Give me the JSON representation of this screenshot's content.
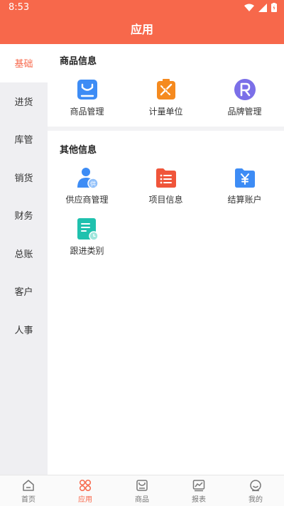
{
  "status_bar": {
    "time": "8:53"
  },
  "header": {
    "title": "应用"
  },
  "sidebar": {
    "items": [
      {
        "label": "基础",
        "active": true
      },
      {
        "label": "进货"
      },
      {
        "label": "库管"
      },
      {
        "label": "销货"
      },
      {
        "label": "财务"
      },
      {
        "label": "总账"
      },
      {
        "label": "客户"
      },
      {
        "label": "人事"
      }
    ]
  },
  "sections": [
    {
      "title": "商品信息",
      "items": [
        {
          "label": "商品管理",
          "icon": "shopping-bag-icon"
        },
        {
          "label": "计量单位",
          "icon": "ruler-pencil-icon"
        },
        {
          "label": "品牌管理",
          "icon": "brand-r-icon"
        }
      ]
    },
    {
      "title": "其他信息",
      "items": [
        {
          "label": "供应商管理",
          "icon": "supplier-icon"
        },
        {
          "label": "项目信息",
          "icon": "list-folder-icon"
        },
        {
          "label": "结算账户",
          "icon": "yen-folder-icon"
        },
        {
          "label": "跟进类别",
          "icon": "follow-note-icon"
        }
      ]
    }
  ],
  "bottom_nav": {
    "tabs": [
      {
        "label": "首页",
        "icon": "home-icon"
      },
      {
        "label": "应用",
        "icon": "apps-icon",
        "active": true
      },
      {
        "label": "商品",
        "icon": "box-icon"
      },
      {
        "label": "报表",
        "icon": "chart-icon"
      },
      {
        "label": "我的",
        "icon": "smile-icon"
      }
    ]
  },
  "colors": {
    "accent": "#F7684B",
    "sidebar_bg": "#efeff2"
  }
}
